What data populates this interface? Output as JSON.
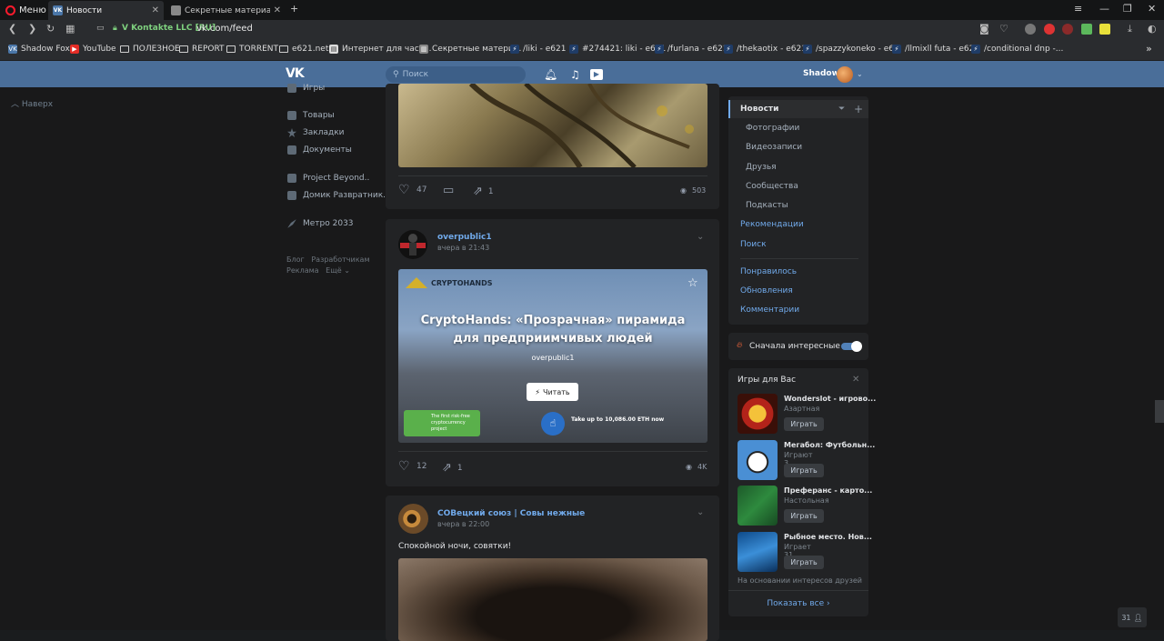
{
  "browser": {
    "menu_label": "Меню",
    "tabs": [
      {
        "title": "Новости",
        "active": true
      },
      {
        "title": "Секретные материалы сер",
        "active": false
      }
    ],
    "secure_label": "V Kontakte LLC [RU]",
    "url": "vk.com/feed"
  },
  "bookmarks": [
    "Shadow Fox",
    "YouTube",
    "ПОЛЕЗНОЕ",
    "REPORT",
    "TORRENT",
    "e621.net",
    "Интернет для част...",
    "Секретные матери...",
    "/liki - e621",
    "#274421: liki - e621",
    "/furlana - e621",
    "/thekaotix - e621",
    "/spazzykoneko - e6...",
    "/llmixll futa - e621",
    "/conditional dnp -..."
  ],
  "header": {
    "logo": "VK",
    "search_placeholder": "Поиск",
    "user_name": "Shadow"
  },
  "left_nav": {
    "up_label": "Наверх",
    "partial_item": "Игры",
    "items": [
      "Товары",
      "Закладки",
      "Документы",
      "Project Beyond..",
      "Домик Развратник..",
      "Метро 2033"
    ],
    "footer": [
      "Блог",
      "Разработчикам",
      "Реклама",
      "Ещё"
    ]
  },
  "posts": [
    {
      "likes": "47",
      "comments": "",
      "shares": "1",
      "views": "503"
    },
    {
      "author": "overpublic1",
      "time": "вчера в 21:43",
      "article_title": "CryptoHands: «Прозрачная» пирамида для предприимчивых людей",
      "article_source": "overpublic1",
      "read_label": "Читать",
      "brand": "CRYPTOHANDS",
      "promo_left": "The first risk-free cryptocurrency project",
      "promo_right": "Take up to 10,086.00 ETH now",
      "likes": "12",
      "shares": "1",
      "views": "4K"
    },
    {
      "author": "СОВецкий союз | Совы нежные",
      "time": "вчера в 22:00",
      "text": "Спокойной ночи, совятки!"
    }
  ],
  "right_menu": {
    "items": [
      {
        "label": "Новости",
        "style": "selected"
      },
      {
        "label": "Фотографии",
        "style": "sub"
      },
      {
        "label": "Видеозаписи",
        "style": "sub"
      },
      {
        "label": "Друзья",
        "style": "sub"
      },
      {
        "label": "Сообщества",
        "style": "sub"
      },
      {
        "label": "Подкасты",
        "style": "sub"
      },
      {
        "label": "Рекомендации",
        "style": "link"
      },
      {
        "label": "Поиск",
        "style": "link"
      },
      {
        "label": "Понравилось",
        "style": "link"
      },
      {
        "label": "Обновления",
        "style": "link"
      },
      {
        "label": "Комментарии",
        "style": "link"
      }
    ],
    "toggle_label": "Сначала интересные"
  },
  "games": {
    "title": "Игры для Вас",
    "list": [
      {
        "name": "Wonderslot - игрово...",
        "sub": "Азартная",
        "button": "Играть"
      },
      {
        "name": "Мегабол: Футбольн...",
        "sub": "Играют 3 друга",
        "button": "Играть"
      },
      {
        "name": "Преферанс - карто...",
        "sub": "Настольная",
        "button": "Играть"
      },
      {
        "name": "Рыбное место. Нов...",
        "sub": "Играет 31 друг",
        "button": "Играть"
      }
    ],
    "note": "На основании интересов друзей",
    "show_all": "Показать все"
  },
  "chat_badge": "31",
  "colors": {
    "header": "#4a6e99",
    "link": "#71aaeb",
    "card": "#222325",
    "bg": "#19191a"
  }
}
